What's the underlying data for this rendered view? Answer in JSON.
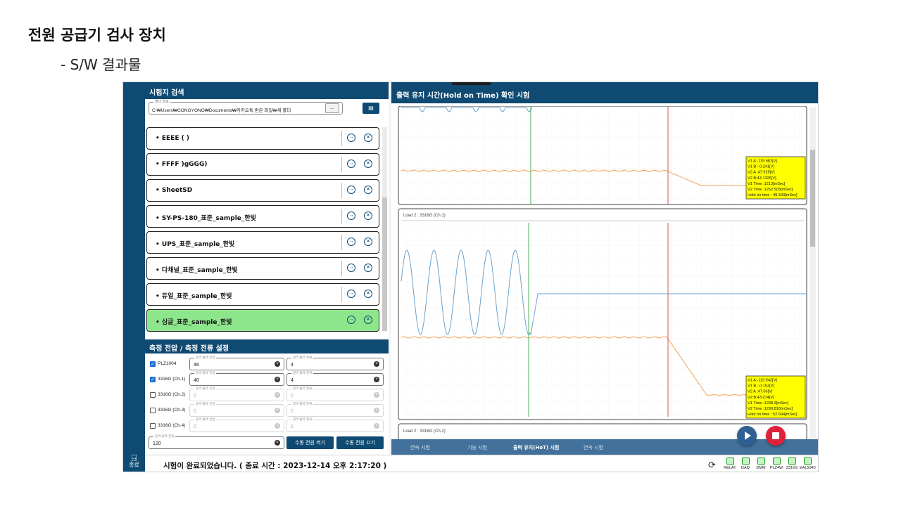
{
  "slide": {
    "title": "전원 공급기 검사 장치",
    "subtitle": "- S/W 결과물"
  },
  "rail": {
    "exit_icon": "exit-icon",
    "exit_label": "종료"
  },
  "left": {
    "header": "시험지 검색",
    "path": {
      "label": "폴더 경로",
      "value": "C:₩Users₩GONGYONG₩Documents₩카카오톡 받은 파일₩새 폴더",
      "browse_label": "...",
      "open_icon": "file-open-icon"
    },
    "items": [
      {
        "label": "EEEE ( )",
        "selected": false
      },
      {
        "label": "FFFF )gGGG)",
        "selected": false
      },
      {
        "label": "SheetSD",
        "selected": false
      },
      {
        "label": "SY-PS-180_표준_sample_한빛",
        "selected": false
      },
      {
        "label": "UPS_표준_sample_한빛",
        "selected": false
      },
      {
        "label": "다채널_표준_sample_한빛",
        "selected": false
      },
      {
        "label": "듀얼_표준_sample_한빛",
        "selected": false
      },
      {
        "label": "싱글_표준_sample_한빛",
        "selected": true
      }
    ],
    "bullet": "•",
    "go_icon_glyph": "→",
    "delete_icon_glyph": "×"
  },
  "measure": {
    "header": "측정 전압 / 측정 전류 설정",
    "voltage_label": "정격 출력 전압",
    "current_label": "정격 출력 전류",
    "rows": [
      {
        "device": "PLZ1004",
        "checked": true,
        "voltage": "48",
        "current": "4"
      },
      {
        "device": "3316G (Ch.1)",
        "checked": true,
        "voltage": "48",
        "current": "4"
      },
      {
        "device": "3316G (Ch.2)",
        "checked": false,
        "voltage": "0",
        "current": "0"
      },
      {
        "device": "3316G (Ch.3)",
        "checked": false,
        "voltage": "0",
        "current": "0"
      },
      {
        "device": "3316G (Ch.4)",
        "checked": false,
        "voltage": "0",
        "current": "0"
      }
    ],
    "input_voltage": {
      "label": "정격 입력 전압",
      "value": "120"
    },
    "power_on": "수동 전원 켜기",
    "power_off": "수동 전원 끄기"
  },
  "status": {
    "message": "시험이 완료되었습니다. ( 종료 시간 : 2023-12-14 오후 2:17:20 )",
    "refresh_icon": "refresh-icon",
    "devices": [
      "RELAY",
      "DAQ",
      "DMM",
      "PLZ4W",
      "3316G",
      "EAL5040"
    ]
  },
  "right": {
    "header": "출력 유지 시간(Hold on Time) 확인 시험",
    "plot1": {
      "readout": [
        "V1 A:-119.581[V]",
        "V1 B :-0.241[V]",
        "V2 A :47.925[V]",
        "V2 B:43.1325[V]",
        "V1 Time :1213[mSec]",
        "V2 Time :1262.503[mSec]",
        "Hold on time : 49.503[mSec]"
      ]
    },
    "plot2": {
      "title": "Load 2 : 3316G (Ch.1)",
      "readout": [
        "V1 A:-119.542[V]",
        "V1 B :-0.153[V]",
        "V2 A :47.06[V]",
        "V2 B:43.074[V]",
        "V1 Time :1238.3[mSec]",
        "V2 Time :1290.816[mSec]",
        "Hold on time : 52.694[mSec]"
      ]
    },
    "plot3": {
      "title": "Load 2 : 3316G (Ch.2)"
    },
    "tabs": [
      "연속 시험",
      "기능 시험",
      "출력 유지(HoT) 시험",
      "연속 시험"
    ],
    "active_tab": 2,
    "colors": {
      "voltage_in": "#6aa3cf",
      "voltage_out": "#f3a35a",
      "cursor_a": "#4caf50",
      "cursor_b": "#e05050",
      "readout_bg": "#ffff00"
    }
  }
}
